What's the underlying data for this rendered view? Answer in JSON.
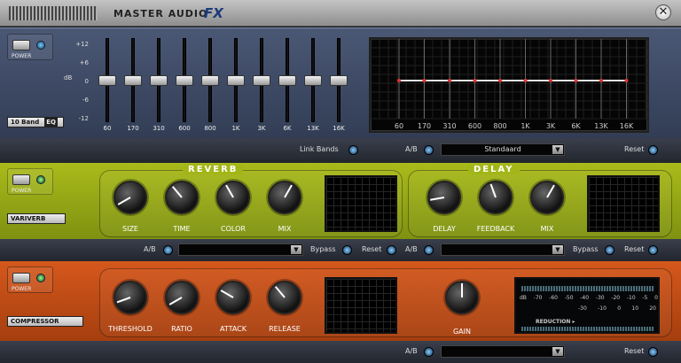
{
  "titlebar": {
    "title": "MASTER AUDIO",
    "fx": "FX",
    "close": "✕"
  },
  "power_label": "POWER",
  "eq": {
    "name": "10 Band",
    "name_suffix": "EQ",
    "db_unit": "dB",
    "db_ticks": [
      "+12",
      "+6",
      "0",
      "-6",
      "-12"
    ],
    "bands": [
      "60",
      "170",
      "310",
      "600",
      "800",
      "1K",
      "3K",
      "6K",
      "13K",
      "16K"
    ],
    "band_values_db": [
      0,
      0,
      0,
      0,
      0,
      0,
      0,
      0,
      0,
      0
    ],
    "graph_labels": [
      "60",
      "170",
      "310",
      "600",
      "800",
      "1K",
      "3K",
      "6K",
      "13K",
      "16K"
    ],
    "link_bands": "Link Bands",
    "ab": "A/B",
    "preset": "Standaard",
    "reset": "Reset"
  },
  "reverb": {
    "title": "REVERB",
    "knobs": [
      "SIZE",
      "TIME",
      "COLOR",
      "MIX"
    ],
    "ab": "A/B",
    "bypass": "Bypass",
    "reset": "Reset"
  },
  "variverb": {
    "name": "VARIVERB"
  },
  "delay": {
    "title": "DELAY",
    "knobs": [
      "DELAY",
      "FEEDBACK",
      "MIX"
    ],
    "ab": "A/B",
    "bypass": "Bypass",
    "reset": "Reset"
  },
  "compressor": {
    "name": "COMPRESSOR",
    "knobs": [
      "THRESHOLD",
      "RATIO",
      "ATTACK",
      "RELEASE"
    ],
    "gain": "GAIN",
    "meter_top": [
      "dB",
      "-70",
      "-60",
      "-50",
      "-40",
      "-30",
      "-20",
      "-10",
      "-5",
      "0"
    ],
    "meter_bottom": [
      "-30",
      "-10",
      "0",
      "10",
      "20"
    ],
    "reduction": "REDUCTION ▸",
    "ab": "A/B",
    "reset": "Reset"
  },
  "colors": {
    "eq_panel": "#3f4b66",
    "reverb_panel": "#9aad16",
    "compressor_panel": "#c74d16",
    "led": "#7cc8ff"
  }
}
